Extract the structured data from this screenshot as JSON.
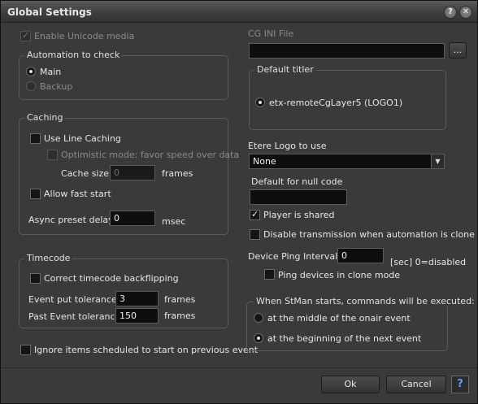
{
  "window": {
    "title": "Global Settings",
    "help_glyph": "?",
    "close_glyph": "✕"
  },
  "left": {
    "enable_unicode": {
      "label": "Enable Unicode media",
      "checked": true,
      "disabled": true
    },
    "automation": {
      "title": "Automation to check",
      "main_label": "Main",
      "backup_label": "Backup",
      "selected": "Main"
    },
    "caching": {
      "title": "Caching",
      "use_line_caching": {
        "label": "Use Line Caching",
        "checked": false
      },
      "optimistic": {
        "label": "Optimistic mode: favor speed over data",
        "checked": false,
        "disabled": true
      },
      "cache_size_label": "Cache size",
      "cache_size_value": "0",
      "cache_size_unit": "frames",
      "allow_fast_start": {
        "label": "Allow fast start",
        "checked": false
      },
      "async_label": "Async preset delay",
      "async_value": "0",
      "async_unit": "msec"
    },
    "timecode": {
      "title": "Timecode",
      "correct_backflipping": {
        "label": "Correct timecode backflipping",
        "checked": false
      },
      "event_put_label": "Event put tolerance",
      "event_put_value": "3",
      "event_put_unit": "frames",
      "past_event_label": "Past Event tolerance",
      "past_event_value": "150",
      "past_event_unit": "frames"
    },
    "ignore_items": {
      "label": "Ignore items scheduled to start on previous event",
      "checked": false
    }
  },
  "right": {
    "cg_ini_label": "CG INI File",
    "cg_ini_value": "",
    "browse_label": "...",
    "default_titler": {
      "title": "Default titler",
      "option_label": "etx-remoteCgLayer5 (LOGO1)",
      "selected": true
    },
    "etere_logo_label": "Etere Logo to use",
    "etere_logo_value": "None",
    "null_code_label": "Default for null code",
    "null_code_value": "",
    "player_shared": {
      "label": "Player is shared",
      "checked": true
    },
    "disable_transmission": {
      "label": "Disable transmission when automation is clone",
      "checked": false
    },
    "ping_label": "Device Ping Interval",
    "ping_value": "0",
    "ping_unit": "[sec] 0=disabled",
    "ping_clone": {
      "label": "Ping devices in clone mode",
      "checked": false
    },
    "stman": {
      "title": "When StMan starts, commands will be executed:",
      "middle_label": "at the middle of the onair event",
      "beginning_label": "at the beginning of the next event",
      "selected": "beginning"
    }
  },
  "footer": {
    "ok_label": "Ok",
    "cancel_label": "Cancel",
    "help_label": "?"
  }
}
